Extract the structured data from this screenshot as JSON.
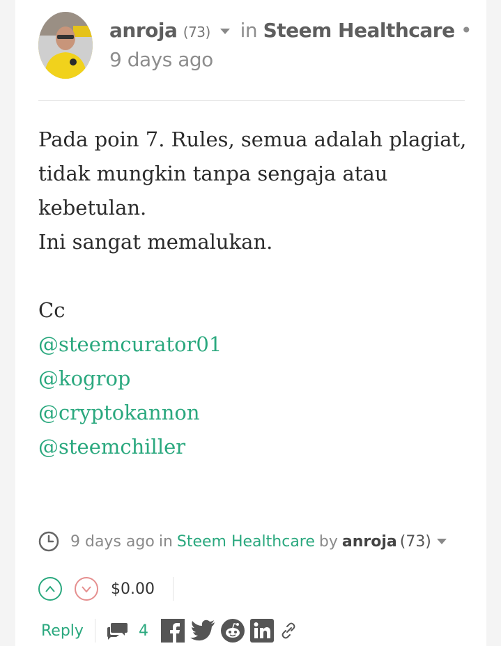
{
  "header": {
    "author": "anroja",
    "reputation": "(73)",
    "in_label": "in",
    "community": "Steem Healthcare",
    "time_prefix": "•",
    "time": "9 days ago"
  },
  "body": {
    "paragraph": "Pada poin 7. Rules, semua adalah plagiat, tidak mungkin tanpa sengaja atau kebetulan.",
    "line2": "Ini sangat memalukan.",
    "cc": "Cc",
    "mentions": [
      "@steemcurator01",
      "@kogrop",
      "@cryptokannon",
      "@steemchiller"
    ]
  },
  "footer": {
    "time": "9 days ago",
    "in_label": "in",
    "community": "Steem Healthcare",
    "by_label": "by",
    "author": "anroja",
    "reputation": "(73)"
  },
  "votes": {
    "payout": "$0.00"
  },
  "actions": {
    "reply_label": "Reply",
    "comment_count": "4"
  },
  "colors": {
    "accent": "#2aa87e",
    "downvote": "#e58f8f"
  },
  "icons": [
    "clock-icon",
    "upvote-icon",
    "downvote-icon",
    "comments-icon",
    "facebook-icon",
    "twitter-icon",
    "reddit-icon",
    "linkedin-icon",
    "link-icon"
  ]
}
